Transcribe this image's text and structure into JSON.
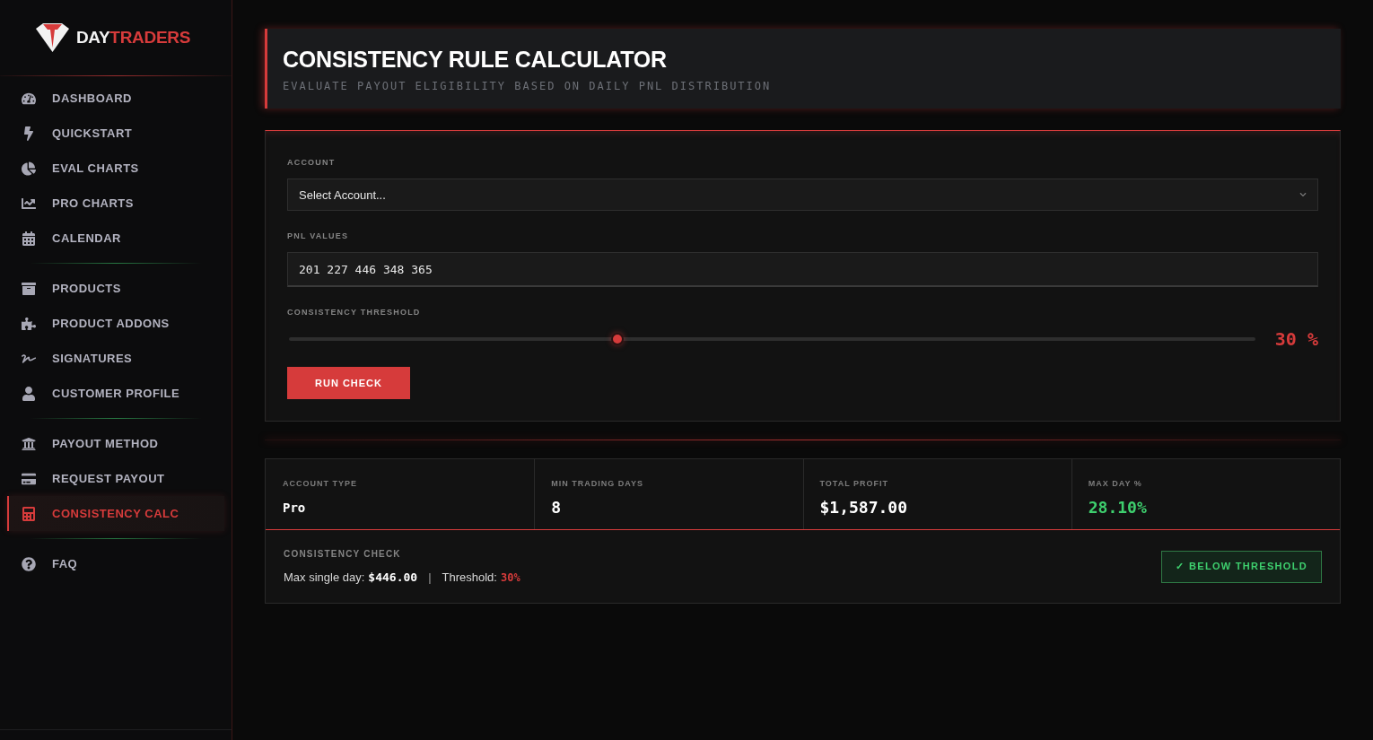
{
  "sidebar": {
    "logo": {
      "first": "DAY",
      "second": "TRADERS"
    },
    "nav_groups": [
      {
        "items": [
          {
            "label": "DASHBOARD",
            "selected": false
          },
          {
            "label": "QUICKSTART",
            "selected": false
          },
          {
            "label": "EVAL CHARTS",
            "selected": false
          },
          {
            "label": "PRO CHARTS",
            "selected": false
          },
          {
            "label": "CALENDAR",
            "selected": false
          }
        ]
      },
      {
        "items": [
          {
            "label": "PRODUCTS",
            "selected": false
          },
          {
            "label": "PRODUCT ADDONS",
            "selected": false
          },
          {
            "label": "SIGNATURES",
            "selected": false
          },
          {
            "label": "CUSTOMER PROFILE",
            "selected": false
          }
        ]
      },
      {
        "items": [
          {
            "label": "PAYOUT METHOD",
            "selected": false
          },
          {
            "label": "REQUEST PAYOUT",
            "selected": false
          },
          {
            "label": "CONSISTENCY CALC",
            "selected": true
          }
        ]
      },
      {
        "items": [
          {
            "label": "FAQ",
            "selected": false
          }
        ]
      }
    ]
  },
  "header": {
    "title": "CONSISTENCY RULE CALCULATOR",
    "subtitle": "EVALUATE PAYOUT ELIGIBILITY BASED ON DAILY PNL DISTRIBUTION"
  },
  "form": {
    "account": {
      "label": "ACCOUNT",
      "value": "Select Account..."
    },
    "pnl_values": {
      "label": "PNL VALUES",
      "value": "201 227 446 348 365"
    },
    "threshold": {
      "label": "CONSISTENCY THRESHOLD",
      "level": 0.34,
      "reading": "30 %"
    },
    "button": "RUN CHECK"
  },
  "results": {
    "stats": [
      {
        "label": "ACCOUNT TYPE",
        "value": "Pro",
        "kind": "text",
        "color": "#ffffff"
      },
      {
        "label": "MIN TRADING DAYS",
        "value": "8",
        "kind": "number",
        "color": "#ffffff"
      },
      {
        "label": "TOTAL PROFIT",
        "value": "$1,587.00",
        "kind": "number",
        "color": "#ffffff"
      },
      {
        "label": "MAX DAY %",
        "value": "28.10%",
        "kind": "number",
        "color": "#3ecf6e"
      }
    ],
    "check": {
      "label": "CONSISTENCY CHECK",
      "max_label": "Max single day:",
      "max_value": "$446.00",
      "separator": "|",
      "threshold_label": "Threshold:",
      "threshold_value": "30%",
      "badge": {
        "text": "✓ BELOW THRESHOLD",
        "passed": true
      }
    }
  }
}
